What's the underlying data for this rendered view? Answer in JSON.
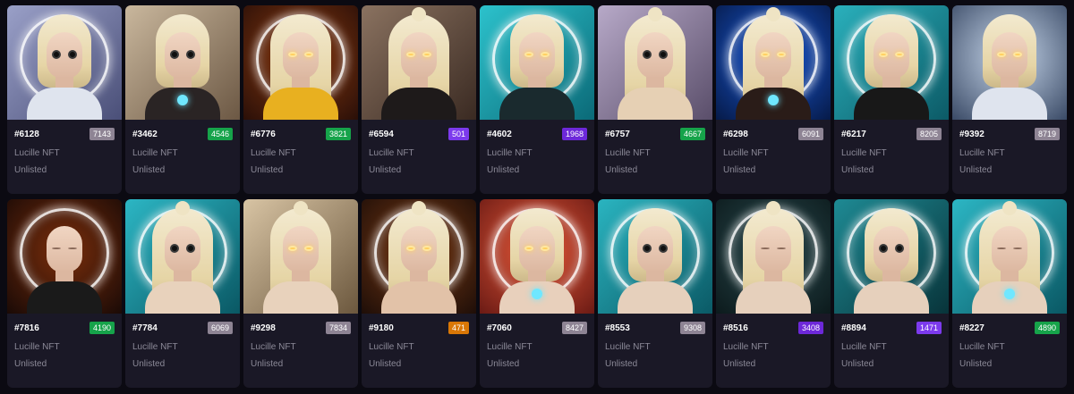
{
  "collection": "Lucille NFT",
  "status": "Unlisted",
  "cards": [
    {
      "id": "#6128",
      "rank": "7143",
      "badge_color": "#8e8494",
      "bg": "linear-gradient(135deg,#9aa0c8,#4a4f78)",
      "ring": true,
      "hair": "short",
      "eyes": "glasses",
      "body": "#dfe4ee",
      "gem": false
    },
    {
      "id": "#3462",
      "rank": "4546",
      "badge_color": "#16a34a",
      "bg": "linear-gradient(135deg,#c9b79d,#6c5844)",
      "ring": false,
      "hair": "short",
      "eyes": "glasses",
      "body": "#2a2424",
      "gem": true
    },
    {
      "id": "#6776",
      "rank": "3821",
      "badge_color": "#16a34a",
      "bg": "radial-gradient(circle at 50% 45%,#8a3a10,#2a0f08)",
      "ring": true,
      "hair": "long",
      "eyes": "glow",
      "body": "#e8b020",
      "gem": false
    },
    {
      "id": "#6594",
      "rank": "501",
      "badge_color": "#7c3aed",
      "bg": "linear-gradient(135deg,#8a7260,#3a2a22)",
      "ring": false,
      "hair": "long",
      "bun": true,
      "eyes": "glow",
      "body": "#1e1a1a",
      "gem": false
    },
    {
      "id": "#4602",
      "rank": "1968",
      "badge_color": "#6d28d9",
      "bg": "linear-gradient(135deg,#2cc2cc,#0b6a78)",
      "ring": true,
      "hair": "short",
      "eyes": "glow",
      "body": "#1a2a2e",
      "gem": false
    },
    {
      "id": "#6757",
      "rank": "4667",
      "badge_color": "#16a34a",
      "bg": "linear-gradient(135deg,#b7a9c8,#5a4e6a)",
      "ring": false,
      "hair": "long",
      "bun": true,
      "eyes": "glasses",
      "body": "#e6d0b4",
      "gem": false
    },
    {
      "id": "#6298",
      "rank": "6091",
      "badge_color": "#8e8494",
      "bg": "radial-gradient(circle at 50% 45%,#1a5ad8,#061a48)",
      "ring": true,
      "hair": "long",
      "bun": true,
      "eyes": "glow",
      "body": "#2a1c18",
      "gem": true
    },
    {
      "id": "#6217",
      "rank": "8205",
      "badge_color": "#8e8494",
      "bg": "linear-gradient(135deg,#2ab0bc,#0c5a66)",
      "ring": true,
      "hair": "short",
      "eyes": "glow",
      "body": "#181818",
      "gem": false
    },
    {
      "id": "#9392",
      "rank": "8719",
      "badge_color": "#8e8494",
      "bg": "radial-gradient(circle at 50% 45%,#c8d8ec,#3a4a66)",
      "ring": false,
      "hair": "short",
      "eyes": "glow",
      "body": "#dfe4ee",
      "gem": false
    },
    {
      "id": "#7816",
      "rank": "4190",
      "badge_color": "#16a34a",
      "bg": "radial-gradient(circle at 50% 45%,#7a2e0c,#1a0a06)",
      "ring": true,
      "hair": "bald",
      "eyes": "closed",
      "body": "#1a1a1a",
      "gem": false
    },
    {
      "id": "#7784",
      "rank": "6069",
      "badge_color": "#8e8494",
      "bg": "linear-gradient(135deg,#2cb6c4,#0a5864)",
      "ring": true,
      "hair": "long",
      "bun": true,
      "eyes": "glasses",
      "body": "#e8d2bc",
      "gem": false
    },
    {
      "id": "#9298",
      "rank": "7834",
      "badge_color": "#8e8494",
      "bg": "linear-gradient(135deg,#d8c4a4,#6c583e)",
      "ring": false,
      "hair": "long",
      "bun": true,
      "eyes": "glow",
      "body": "#e8d2bc",
      "gem": false
    },
    {
      "id": "#9180",
      "rank": "471",
      "badge_color": "#d97706",
      "bg": "radial-gradient(circle at 50% 45%,#7a3a14,#1e0e08)",
      "ring": true,
      "hair": "long",
      "bun": true,
      "eyes": "glow",
      "body": "#e2c2a8",
      "gem": false
    },
    {
      "id": "#7060",
      "rank": "8427",
      "badge_color": "#8e8494",
      "bg": "radial-gradient(circle at 50% 45%,#e85a3a,#6a1a14)",
      "ring": true,
      "hair": "short",
      "eyes": "glow",
      "body": "#e8d0bc",
      "gem": true
    },
    {
      "id": "#8553",
      "rank": "9308",
      "badge_color": "#8e8494",
      "bg": "linear-gradient(135deg,#2ab4c0,#0b5a66)",
      "ring": true,
      "hair": "short",
      "eyes": "glasses",
      "body": "#e6d0bc",
      "gem": false
    },
    {
      "id": "#8516",
      "rank": "3408",
      "badge_color": "#6d28d9",
      "bg": "radial-gradient(circle at 50% 45%,#2a4a4e,#0c1a1c)",
      "ring": true,
      "hair": "long",
      "bun": true,
      "eyes": "closed",
      "body": "#e6d0bc",
      "gem": false
    },
    {
      "id": "#8894",
      "rank": "1471",
      "badge_color": "#7c3aed",
      "bg": "linear-gradient(135deg,#1e8a94,#08343a)",
      "ring": true,
      "hair": "short",
      "eyes": "glasses",
      "body": "#e6d0bc",
      "gem": false
    },
    {
      "id": "#8227",
      "rank": "4890",
      "badge_color": "#16a34a",
      "bg": "linear-gradient(135deg,#2cb6c4,#0a5864)",
      "ring": true,
      "hair": "long",
      "bun": true,
      "eyes": "closed",
      "body": "#e6d0bc",
      "gem": true
    }
  ]
}
